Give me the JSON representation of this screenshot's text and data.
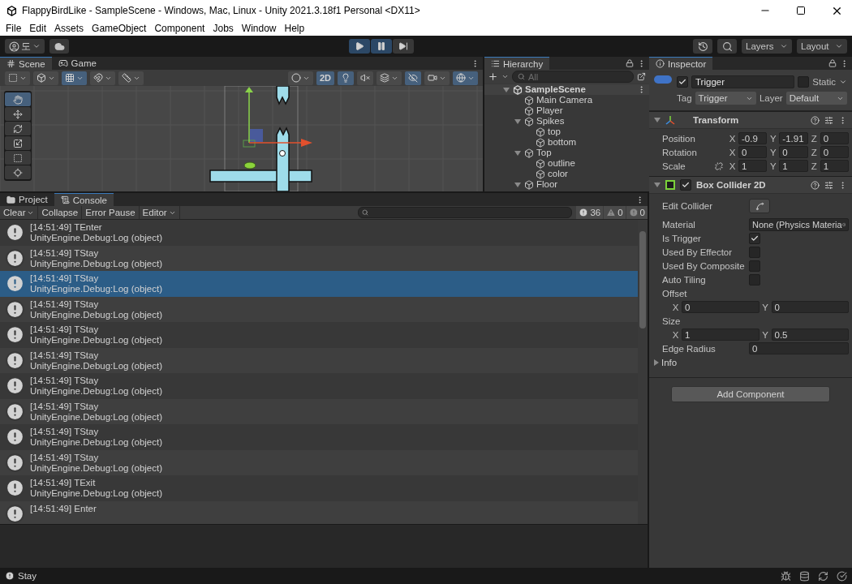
{
  "window": {
    "title": "FlappyBirdLike - SampleScene - Windows, Mac, Linux - Unity 2021.3.18f1 Personal <DX11>"
  },
  "menu": [
    "File",
    "Edit",
    "Assets",
    "GameObject",
    "Component",
    "Jobs",
    "Window",
    "Help"
  ],
  "toolbar": {
    "account": "도",
    "play_controls": [
      {
        "on": true
      },
      {
        "on": true
      },
      {
        "on": false
      }
    ],
    "layers": "Layers",
    "layout": "Layout"
  },
  "scene": {
    "tabs": [
      {
        "label": "Scene",
        "selected": true
      },
      {
        "label": "Game",
        "selected": false
      }
    ],
    "left_toggles": [
      {
        "on": false
      },
      {
        "on": false
      },
      {
        "on": true
      },
      {
        "on": false
      },
      {
        "on": false
      }
    ],
    "right_toggles": [
      {
        "on": false
      },
      {
        "label": "2D",
        "on": true
      },
      {
        "on": true
      },
      {
        "on": false
      },
      {
        "on": false
      },
      {
        "on": true
      },
      {
        "on": false
      },
      {
        "on": true
      }
    ],
    "tools": [
      {
        "selected": true
      },
      {
        "selected": false
      },
      {
        "selected": false
      },
      {
        "selected": false
      },
      {
        "selected": false
      },
      {
        "selected": false
      }
    ]
  },
  "hierarchy": {
    "tab": "Hierarchy",
    "search": {
      "placeholder": "All"
    },
    "items": [
      {
        "label": "SampleScene",
        "kind": "scene",
        "expanded": true,
        "children": [
          {
            "label": "Main Camera",
            "kind": "object"
          },
          {
            "label": "Player",
            "kind": "object"
          },
          {
            "label": "Spikes",
            "kind": "object",
            "expanded": true,
            "children": [
              {
                "label": "top",
                "kind": "object"
              },
              {
                "label": "bottom",
                "kind": "object"
              }
            ]
          },
          {
            "label": "Top",
            "kind": "object",
            "expanded": true,
            "children": [
              {
                "label": "outline",
                "kind": "object"
              },
              {
                "label": "color",
                "kind": "object"
              }
            ]
          },
          {
            "label": "Floor",
            "kind": "object",
            "expanded": true
          }
        ]
      }
    ]
  },
  "console": {
    "tabs": [
      {
        "label": "Project",
        "selected": false
      },
      {
        "label": "Console",
        "selected": true
      }
    ],
    "buttons": [
      {
        "label": "Clear",
        "dropdown": true
      },
      {
        "label": "Collapse",
        "dropdown": false
      },
      {
        "label": "Error Pause",
        "dropdown": false
      },
      {
        "label": "Editor",
        "dropdown": true
      }
    ],
    "counts": [
      {
        "kind": "log",
        "count": "36"
      },
      {
        "kind": "warning",
        "count": "0"
      },
      {
        "kind": "error",
        "count": "0"
      }
    ],
    "entries": [
      {
        "text": "[14:51:49] TEnter",
        "source": "UnityEngine.Debug:Log (object)",
        "selected": false
      },
      {
        "text": "[14:51:49] TStay",
        "source": "UnityEngine.Debug:Log (object)",
        "selected": false
      },
      {
        "text": "[14:51:49] TStay",
        "source": "UnityEngine.Debug:Log (object)",
        "selected": true
      },
      {
        "text": "[14:51:49] TStay",
        "source": "UnityEngine.Debug:Log (object)",
        "selected": false
      },
      {
        "text": "[14:51:49] TStay",
        "source": "UnityEngine.Debug:Log (object)",
        "selected": false
      },
      {
        "text": "[14:51:49] TStay",
        "source": "UnityEngine.Debug:Log (object)",
        "selected": false
      },
      {
        "text": "[14:51:49] TStay",
        "source": "UnityEngine.Debug:Log (object)",
        "selected": false
      },
      {
        "text": "[14:51:49] TStay",
        "source": "UnityEngine.Debug:Log (object)",
        "selected": false
      },
      {
        "text": "[14:51:49] TStay",
        "source": "UnityEngine.Debug:Log (object)",
        "selected": false
      },
      {
        "text": "[14:51:49] TStay",
        "source": "UnityEngine.Debug:Log (object)",
        "selected": false
      },
      {
        "text": "[14:51:49] TExit",
        "source": "UnityEngine.Debug:Log (object)",
        "selected": false
      },
      {
        "text": "[14:51:49] Enter",
        "selected": false
      }
    ]
  },
  "inspector": {
    "tab": "Inspector",
    "object": {
      "active": true,
      "name": "Trigger",
      "static_label": "Static",
      "is_static": false,
      "tag_label": "Tag",
      "tag": "Trigger",
      "layer_label": "Layer",
      "layer": "Default"
    },
    "transform": {
      "title": "Transform",
      "expanded": true,
      "rows": [
        {
          "label": "Position",
          "fields": [
            {
              "axis": "X",
              "value": "-0.9"
            },
            {
              "axis": "Y",
              "value": "-1.91"
            },
            {
              "axis": "Z",
              "value": "0"
            }
          ]
        },
        {
          "label": "Rotation",
          "fields": [
            {
              "axis": "X",
              "value": "0"
            },
            {
              "axis": "Y",
              "value": "0"
            },
            {
              "axis": "Z",
              "value": "0"
            }
          ]
        },
        {
          "label": "Scale",
          "constrained": false,
          "fields": [
            {
              "axis": "X",
              "value": "1"
            },
            {
              "axis": "Y",
              "value": "1"
            },
            {
              "axis": "Z",
              "value": "1"
            }
          ]
        }
      ]
    },
    "box_collider": {
      "title": "Box Collider 2D",
      "enabled": true,
      "expanded": true,
      "properties": [
        {
          "kind": "edit",
          "label": "Edit Collider"
        },
        {
          "kind": "object",
          "label": "Material",
          "value": "None (Physics Materia"
        },
        {
          "kind": "toggle",
          "label": "Is Trigger",
          "checked": true
        },
        {
          "kind": "toggle",
          "label": "Used By Effector",
          "checked": false
        },
        {
          "kind": "toggle",
          "label": "Used By Composite",
          "checked": false
        },
        {
          "kind": "toggle",
          "label": "Auto Tiling",
          "checked": false
        },
        {
          "kind": "header",
          "label": "Offset"
        },
        {
          "kind": "vector",
          "fields": [
            {
              "axis": "X",
              "value": "0"
            },
            {
              "axis": "Y",
              "value": "0"
            }
          ]
        },
        {
          "kind": "header",
          "label": "Size"
        },
        {
          "kind": "vector",
          "fields": [
            {
              "axis": "X",
              "value": "1"
            },
            {
              "axis": "Y",
              "value": "0.5"
            }
          ]
        },
        {
          "kind": "float",
          "label": "Edge Radius",
          "value": "0"
        },
        {
          "kind": "foldout",
          "label": "Info",
          "expanded": false
        }
      ]
    },
    "add_component": "Add Component"
  },
  "status_bar": {
    "message": "Stay"
  }
}
